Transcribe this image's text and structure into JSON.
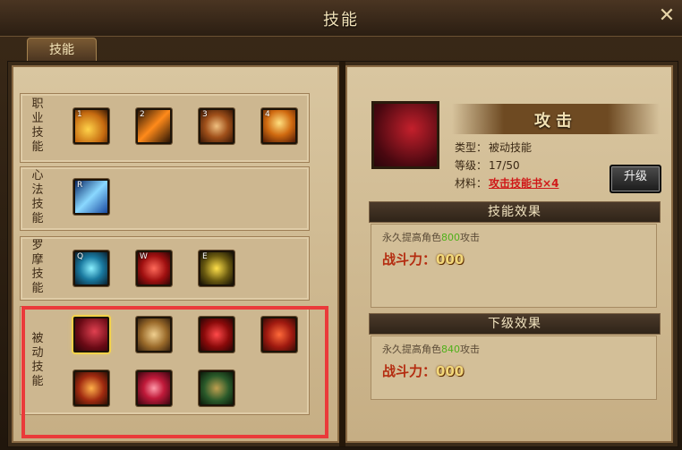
{
  "window": {
    "title": "技能",
    "close_label": "✕"
  },
  "tabs": [
    {
      "label": "技能"
    }
  ],
  "skill_groups": [
    {
      "label": "职业技能",
      "skills": [
        {
          "key": "1",
          "name": "career-skill-1"
        },
        {
          "key": "2",
          "name": "career-skill-2"
        },
        {
          "key": "3",
          "name": "career-skill-3"
        },
        {
          "key": "4",
          "name": "career-skill-4"
        }
      ]
    },
    {
      "label": "心法技能",
      "skills": [
        {
          "key": "R",
          "name": "mind-skill-r"
        }
      ]
    },
    {
      "label": "罗摩技能",
      "skills": [
        {
          "key": "Q",
          "name": "luomo-skill-q"
        },
        {
          "key": "W",
          "name": "luomo-skill-w"
        },
        {
          "key": "E",
          "name": "luomo-skill-e"
        }
      ]
    },
    {
      "label": "被动技能",
      "skills": [
        {
          "key": "",
          "name": "passive-attack"
        },
        {
          "key": "",
          "name": "passive-shield"
        },
        {
          "key": "",
          "name": "passive-vortex"
        },
        {
          "key": "",
          "name": "passive-heart"
        },
        {
          "key": "",
          "name": "passive-runner"
        },
        {
          "key": "",
          "name": "passive-burst"
        },
        {
          "key": "",
          "name": "passive-cross"
        }
      ]
    }
  ],
  "selected_skill": {
    "name": "攻击",
    "type_label": "类型：",
    "type_value": "被动技能",
    "level_label": "等级：",
    "level_value": "17/50",
    "material_label": "材料：",
    "material_value": "攻击技能书×4",
    "upgrade_label": "升级"
  },
  "current_effect": {
    "header": "技能效果",
    "desc_prefix": "永久提高角色",
    "desc_value": "800",
    "desc_suffix": "攻击",
    "power_label": "战斗力：",
    "power_value": "000"
  },
  "next_effect": {
    "header": "下级效果",
    "desc_prefix": "永久提高角色",
    "desc_value": "840",
    "desc_suffix": "攻击",
    "power_label": "战斗力：",
    "power_value": "000"
  },
  "colors": {
    "highlight": "#ea3a3a",
    "selected_glow": "#f3d24a",
    "effect_number": "#4fb01a",
    "material_link": "#d01818"
  }
}
